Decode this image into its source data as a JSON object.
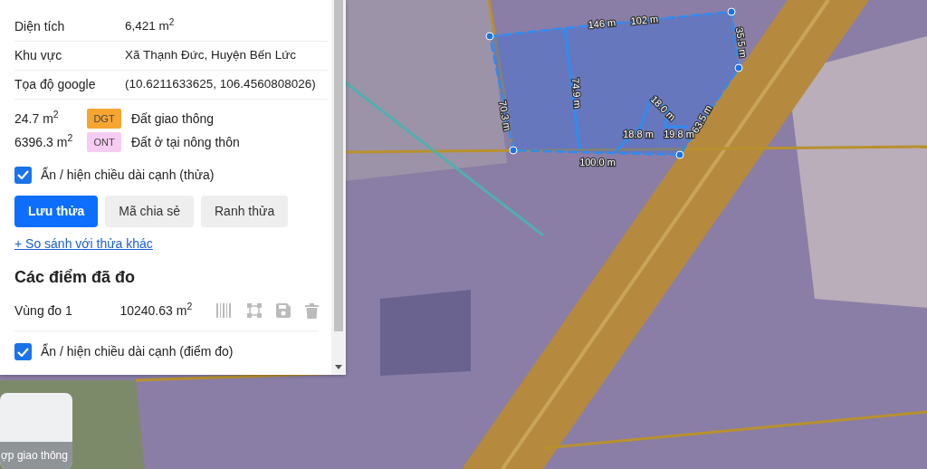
{
  "parcel_info": [
    {
      "label": "Diện tích",
      "value": "6,421 m$^{2}$"
    },
    {
      "label": "Khu vực",
      "value": "Xã Thạnh Đức, Huyện Bến Lức"
    },
    {
      "label": "Tọa độ google",
      "value": "(10.6211633625, 106.4560808026)"
    }
  ],
  "land_uses": [
    {
      "area": "24.7 m$^{2}$",
      "code": "DGT",
      "color": "#f7a531",
      "name": "Đất giao thông"
    },
    {
      "area": "6396.3 m$^{2}$",
      "code": "ONT",
      "color": "#f6cdf2",
      "name": "Đất ở tại nông thôn"
    }
  ],
  "parcel_edges_toggle": {
    "label": "Ẩn / hiện chiều dài cạnh (thửa)",
    "checked": true
  },
  "buttons": [
    {
      "label": "Lưu thửa",
      "kind": "primary"
    },
    {
      "label": "Mã chia sẻ",
      "kind": "secondary"
    },
    {
      "label": "Ranh thửa",
      "kind": "secondary"
    }
  ],
  "compare_link": "+ So sánh với thửa khác",
  "measured": {
    "title": "Các điểm đã đo",
    "items": [
      {
        "name": "Vùng đo 1",
        "area": "10240.63 m$^{2}$"
      }
    ]
  },
  "measure_edges_toggle": {
    "label": "Ẩn / hiện chiều dài cạnh (điểm đo)",
    "checked": true
  },
  "map": {
    "edge_labels": [
      "146 m",
      "102 m",
      "35.5 m",
      "70.3 m",
      "74.9 m",
      "18.0 m",
      "18.8 m",
      "19.8 m",
      "63.5 m",
      "100.0 m"
    ],
    "layer_thumbnail": {
      "label": "ợp giao thông"
    }
  }
}
